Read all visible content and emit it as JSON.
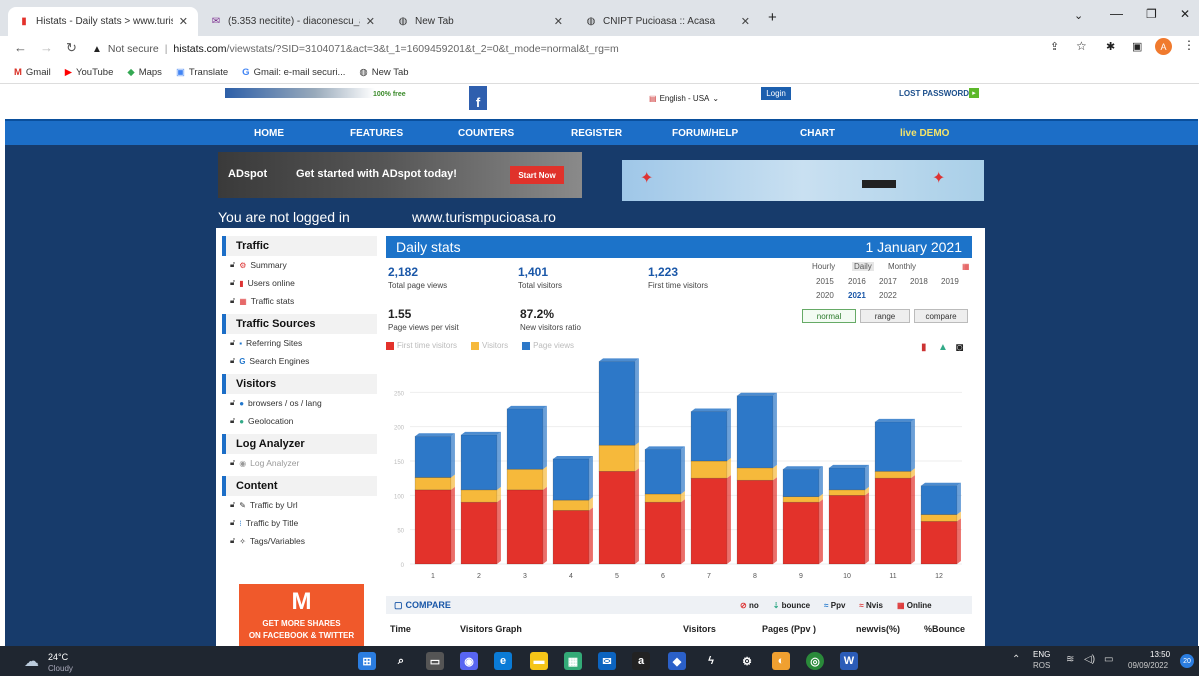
{
  "browser": {
    "tabs": [
      {
        "title": "Histats - Daily stats > www.turis",
        "active": true
      },
      {
        "title": "(5.353 necitite) - diaconescu_an"
      },
      {
        "title": "New Tab"
      },
      {
        "title": "CNIPT Pucioasa :: Acasa"
      }
    ],
    "new_tab": "+",
    "url_security": "Not secure",
    "url_host": "histats.com",
    "url_path": "/viewstats/?SID=3104071&act=3&t_1=1609459201&t_2=0&t_mode=normal&t_rg=m",
    "profile_initial": "A",
    "bookmarks": [
      "Gmail",
      "YouTube",
      "Maps",
      "Translate",
      "Gmail: e-mail securi...",
      "New Tab"
    ]
  },
  "site": {
    "logo_tag": "100% free",
    "language": "English - USA",
    "login_label": "Login",
    "lost_password": "LOST PASSWORD",
    "menu": [
      "HOME",
      "FEATURES",
      "COUNTERS",
      "REGISTER",
      "FORUM/HELP",
      "CHART",
      "live DEMO"
    ],
    "ad": {
      "brand": "ADspot",
      "text": "Get started with ADspot today!",
      "cta": "Start Now"
    },
    "not_logged": "You are not logged in",
    "site_url": "www.turismpucioasa.ro"
  },
  "sidebar": {
    "sections": [
      {
        "title": "Traffic",
        "items": [
          "Summary",
          "Users online",
          "Traffic stats"
        ]
      },
      {
        "title": "Traffic Sources",
        "items": [
          "Referring Sites",
          "Search Engines"
        ]
      },
      {
        "title": "Visitors",
        "items": [
          "browsers / os / lang",
          "Geolocation"
        ]
      },
      {
        "title": "Log Analyzer",
        "items": [
          "Log Analyzer"
        ]
      },
      {
        "title": "Content",
        "items": [
          "Traffic by Url",
          "Traffic by Title",
          "Tags/Variables"
        ]
      }
    ],
    "promo": {
      "line1": "GET MORE SHARES",
      "line2": "ON FACEBOOK & TWITTER"
    }
  },
  "stats": {
    "title": "Daily stats",
    "date": "1 January 2021",
    "total_page_views": {
      "value": "2,182",
      "label": "Total page views"
    },
    "total_visitors": {
      "value": "1,401",
      "label": "Total visitors"
    },
    "first_time_visitors": {
      "value": "1,223",
      "label": "First time visitors"
    },
    "ppv": {
      "value": "1.55",
      "label": "Page views per visit"
    },
    "new_ratio": {
      "value": "87.2%",
      "label": "New visitors ratio"
    },
    "period_modes": [
      "Hourly",
      "Daily",
      "Monthly"
    ],
    "years": [
      "2015",
      "2016",
      "2017",
      "2018",
      "2019",
      "2020",
      "2021",
      "2022"
    ],
    "selected_year": "2021",
    "view_modes": [
      "normal",
      "range",
      "compare"
    ]
  },
  "chart_data": {
    "type": "bar",
    "stacked": true,
    "categories": [
      "1",
      "2",
      "3",
      "4",
      "5",
      "6",
      "7",
      "8",
      "9",
      "10",
      "11",
      "12"
    ],
    "series": [
      {
        "name": "First time visitors",
        "color": "#e3322b",
        "values": [
          108,
          90,
          108,
          78,
          135,
          90,
          125,
          122,
          90,
          100,
          125,
          62
        ]
      },
      {
        "name": "Visitors",
        "color": "#f6b93b",
        "values": [
          18,
          18,
          30,
          15,
          38,
          12,
          25,
          18,
          8,
          8,
          10,
          10
        ]
      },
      {
        "name": "Page views",
        "color": "#2d78c8",
        "values": [
          60,
          80,
          88,
          60,
          122,
          65,
          72,
          105,
          40,
          32,
          72,
          42
        ]
      }
    ],
    "yticks": [
      "0",
      "50",
      "100",
      "150",
      "200",
      "250"
    ],
    "ylim": [
      0,
      300
    ]
  },
  "compare": {
    "label": "COMPARE",
    "legend": [
      "no",
      "bounce",
      "Ppv",
      "Nvis",
      "Online"
    ],
    "columns": [
      "Time",
      "Visitors Graph",
      "Visitors",
      "Pages (Ppv )",
      "newvis(%)",
      "%Bounce"
    ]
  },
  "taskbar": {
    "temp": "24°C",
    "weather": "Cloudy",
    "lang": "ENG",
    "lang2": "ROS",
    "time": "13:50",
    "date": "09/09/2022",
    "notifications": "20"
  }
}
